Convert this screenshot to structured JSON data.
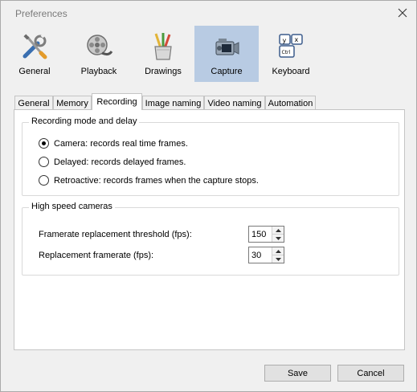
{
  "window": {
    "title": "Preferences"
  },
  "categories": [
    {
      "label": "General",
      "icon": "tools-icon"
    },
    {
      "label": "Playback",
      "icon": "film-reel-icon"
    },
    {
      "label": "Drawings",
      "icon": "pencil-cup-icon"
    },
    {
      "label": "Capture",
      "icon": "camera-icon",
      "selected": true
    },
    {
      "label": "Keyboard",
      "icon": "keyboard-keys-icon"
    }
  ],
  "tabs": [
    {
      "label": "General"
    },
    {
      "label": "Memory"
    },
    {
      "label": "Recording",
      "active": true
    },
    {
      "label": "Image naming"
    },
    {
      "label": "Video naming"
    },
    {
      "label": "Automation"
    }
  ],
  "recording_group": {
    "title": "Recording mode and delay",
    "options": [
      {
        "label": "Camera: records real time frames.",
        "checked": true
      },
      {
        "label": "Delayed: records delayed frames.",
        "checked": false
      },
      {
        "label": "Retroactive: records frames when the capture stops.",
        "checked": false
      }
    ]
  },
  "highspeed_group": {
    "title": "High speed cameras",
    "threshold_label": "Framerate replacement threshold (fps):",
    "threshold_value": "150",
    "replacement_label": "Replacement framerate (fps):",
    "replacement_value": "30"
  },
  "buttons": {
    "save": "Save",
    "cancel": "Cancel"
  },
  "colors": {
    "selected_category_bg": "#b8cbe3",
    "window_bg": "#f0f0f0"
  }
}
